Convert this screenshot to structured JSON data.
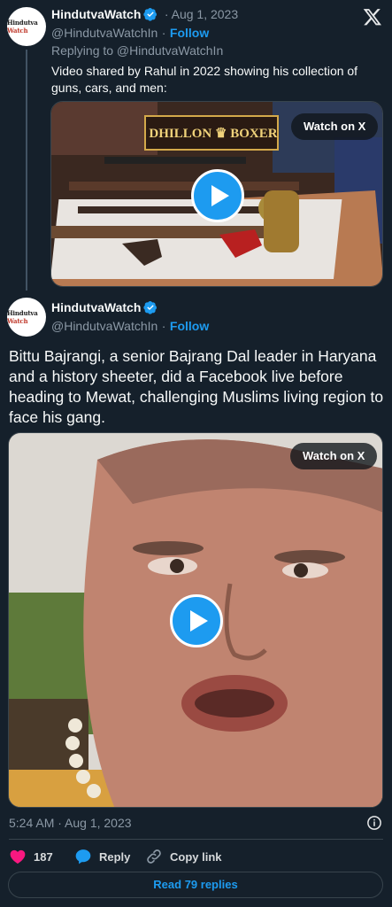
{
  "x_logo": "x-logo-icon",
  "reply_tweet": {
    "avatar_text": "Hindutva Watch",
    "name": "HindutvaWatch",
    "date": "· Aug 1, 2023",
    "handle": "@HindutvaWatchIn",
    "follow_sep": "·",
    "follow": "Follow",
    "replying_to": "Replying to @HindutvaWatchIn",
    "text": "Video shared by Rahul in 2022 showing his collection of guns, cars, and men:",
    "video": {
      "watch_label": "Watch on X",
      "sign_text_left": "DHILLON",
      "sign_text_right": "BOXER"
    }
  },
  "main_tweet": {
    "avatar_text": "Hindutva Watch",
    "name": "HindutvaWatch",
    "handle": "@HindutvaWatchIn",
    "follow_sep": "·",
    "follow": "Follow",
    "text": "Bittu Bajrangi, a senior Bajrang Dal leader in Haryana and a history sheeter, did a Facebook live before heading to Mewat, challenging Muslims living region to face his gang.",
    "video": {
      "watch_label": "Watch on X"
    },
    "timestamp": "5:24 AM · Aug 1, 2023",
    "likes": "187",
    "reply_label": "Reply",
    "copy_link_label": "Copy link",
    "read_replies": "Read 79 replies"
  },
  "colors": {
    "accent": "#1d9bf0",
    "background": "#15202b",
    "like": "#f91880"
  }
}
